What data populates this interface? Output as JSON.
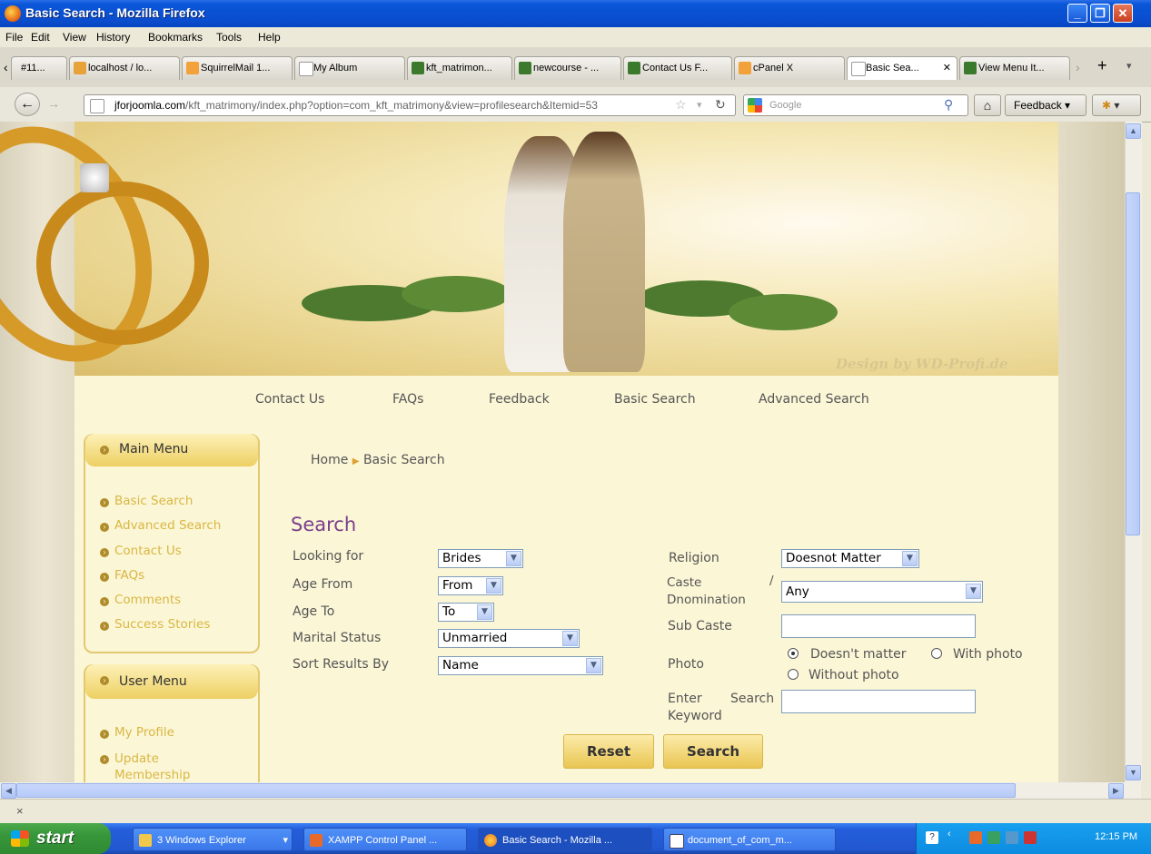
{
  "window": {
    "title": "Basic Search - Mozilla Firefox"
  },
  "menubar": [
    "File",
    "Edit",
    "View",
    "History",
    "Bookmarks",
    "Tools",
    "Help"
  ],
  "tabs": [
    {
      "label": "#11...",
      "color": "#e9e6dc"
    },
    {
      "label": "localhost / lo...",
      "color": "#e8a23a"
    },
    {
      "label": "SquirrelMail 1...",
      "color": "#f2a13b"
    },
    {
      "label": "My Album",
      "color": "#ffffff"
    },
    {
      "label": "kft_matrimon...",
      "color": "#3b7a2d"
    },
    {
      "label": "newcourse - ...",
      "color": "#3b7a2d"
    },
    {
      "label": "Contact Us F...",
      "color": "#3b7a2d"
    },
    {
      "label": "cPanel X",
      "color": "#f2a13b"
    },
    {
      "label": "Basic Sea...",
      "color": "#ffffff"
    },
    {
      "label": "View Menu It...",
      "color": "#3b7a2d"
    }
  ],
  "nav": {
    "url_host": "jforjoomla.com",
    "url_path": "/kft_matrimony/index.php?option=com_kft_matrimony&view=profilesearch&Itemid=53",
    "search_placeholder": "Google",
    "feedback": "Feedback"
  },
  "site": {
    "watermark": "Design by WD-Profi.de",
    "top_links": [
      "Contact Us",
      "FAQs",
      "Feedback",
      "Basic Search",
      "Advanced Search"
    ],
    "breadcrumb": {
      "home": "Home",
      "current": "Basic Search"
    },
    "main_menu": {
      "title": "Main Menu",
      "items": [
        "Basic Search",
        "Advanced Search",
        "Contact Us",
        "FAQs",
        "Comments",
        "Success Stories"
      ]
    },
    "user_menu": {
      "title": "User Menu",
      "items": [
        "My Profile",
        "Update Membership"
      ]
    }
  },
  "form": {
    "heading": "Search",
    "looking_for": {
      "label": "Looking for",
      "value": "Brides"
    },
    "age_from": {
      "label": "Age From",
      "value": "From"
    },
    "age_to": {
      "label": "Age To",
      "value": "To"
    },
    "marital_status": {
      "label": "Marital Status",
      "value": "Unmarried"
    },
    "sort_by": {
      "label": "Sort Results By",
      "value": "Name"
    },
    "religion": {
      "label": "Religion",
      "value": "Doesnot Matter"
    },
    "caste": {
      "label_line1": "Caste",
      "label_slash": "/",
      "label_line2": "Dnomination",
      "value": "Any"
    },
    "sub_caste": {
      "label": "Sub Caste",
      "value": ""
    },
    "photo": {
      "label": "Photo",
      "options": [
        "Doesn't matter",
        "With photo",
        "Without photo"
      ],
      "selected": "Doesn't matter"
    },
    "keyword": {
      "label_line1a": "Enter",
      "label_line1b": "Search",
      "label_line2": "Keyword",
      "value": ""
    },
    "reset_label": "Reset",
    "search_label": "Search"
  },
  "statusbar": {
    "close": "×"
  },
  "taskbar": {
    "start": "start",
    "tasks": [
      "3 Windows Explorer",
      "XAMPP Control Panel ...",
      "Basic Search - Mozilla ...",
      "document_of_com_m..."
    ],
    "clock": "12:15 PM"
  }
}
